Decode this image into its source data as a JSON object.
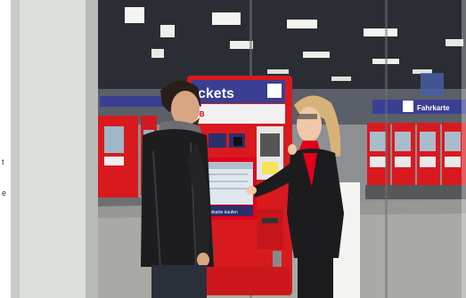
{
  "photo": {
    "kiosk_header": "ckets",
    "kiosk_brand": "DB",
    "station_sign": "Fahrkarte",
    "screen_footer": "Fahrkarte kaufen",
    "edge_letters": [
      "t",
      "e"
    ]
  },
  "colors": {
    "db_red": "#e2001a",
    "kiosk_red": "#d81a1f",
    "sign_blue": "#3a3f93",
    "ceiling": "#2a2d33",
    "floor": "#a9a9a5"
  }
}
